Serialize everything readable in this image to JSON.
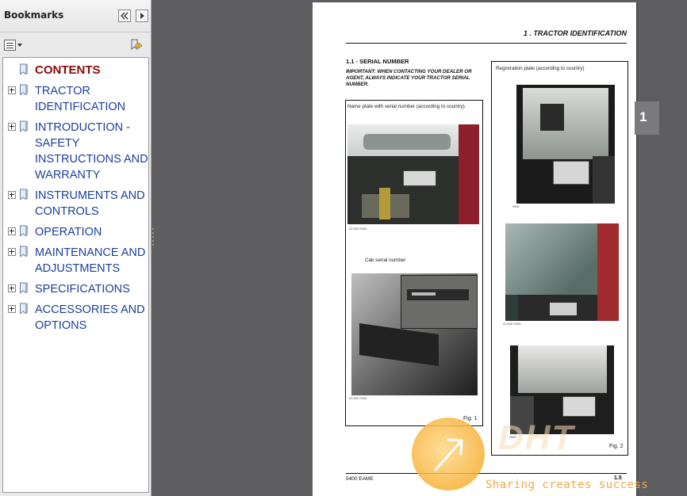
{
  "panel": {
    "title": "Bookmarks",
    "icons": {
      "collapse": "double-chevron-left-icon",
      "close": "chevron-right-icon",
      "options": "options-menu-icon",
      "expand": "expand-bookmark-icon"
    },
    "bookmarks": [
      {
        "label": "CONTENTS",
        "active": true,
        "expandable": false
      },
      {
        "label": "TRACTOR IDENTIFICATION",
        "expandable": true
      },
      {
        "label": "INTRODUCTION - SAFETY INSTRUCTIONS AND WARRANTY",
        "expandable": true
      },
      {
        "label": "INSTRUMENTS AND CONTROLS",
        "expandable": true
      },
      {
        "label": "OPERATION",
        "expandable": true
      },
      {
        "label": "MAINTENANCE AND ADJUSTMENTS",
        "expandable": true
      },
      {
        "label": "SPECIFICATIONS",
        "expandable": true
      },
      {
        "label": "ACCESSORIES AND OPTIONS",
        "expandable": true
      }
    ]
  },
  "document": {
    "header": "1 . TRACTOR IDENTIFICATION",
    "section_title": "1.1 -  SERIAL NUMBER",
    "section_note": "IMPORTANT: WHEN CONTACTING YOUR DEALER OR AGENT, ALWAYS INDICATE YOUR TRACTOR SERIAL NUMBER.",
    "left_box": {
      "caption_name_plate": "Name plate with serial number (according to country).",
      "caption_cab": "Cab serial number",
      "photo_code_1": "Z2.320.TG05",
      "photo_code_2": "Z2.320.TG05",
      "figure_label": "Fig. 1"
    },
    "right_box": {
      "caption": "Registration plate (according to country)",
      "photo_code_1": "0996",
      "photo_code_2": "Z2.320.TG05",
      "photo_code_3": "0993",
      "figure_label": "Fig. 2"
    },
    "footer_left": "5400 EAME",
    "footer_right": "1.5",
    "chapter_tab": "1"
  },
  "watermark": {
    "logo": "DHT",
    "tagline": "Sharing creates success"
  },
  "colors": {
    "bookmark_link": "#1c3f9c",
    "bookmark_active": "#8b0a0a",
    "viewer_background": "#5e5e60",
    "chapter_tab": "#7a7a7c",
    "watermark_accent": "#f4a84a"
  }
}
